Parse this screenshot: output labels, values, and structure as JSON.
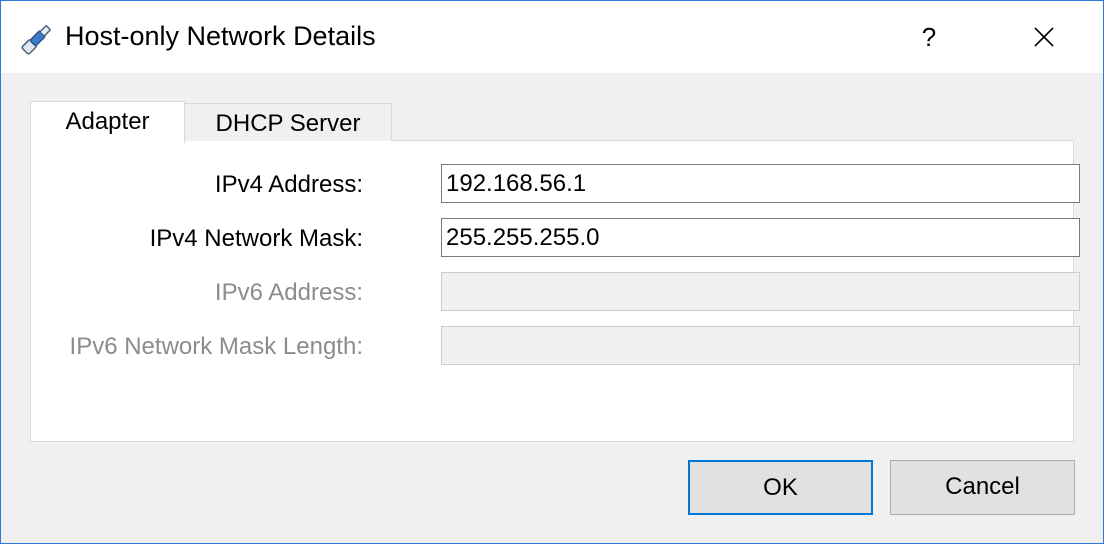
{
  "window": {
    "title": "Host-only Network Details",
    "icon": "network-adapter-icon",
    "help_label": "?",
    "close_icon": "close-icon",
    "accent_color": "#2b79d8"
  },
  "tabs": [
    {
      "label": "Adapter",
      "selected": true
    },
    {
      "label": "DHCP Server",
      "selected": false
    }
  ],
  "fields": {
    "ipv4_address": {
      "label": "IPv4 Address:",
      "value": "192.168.56.1",
      "enabled": true
    },
    "ipv4_mask": {
      "label": "IPv4 Network Mask:",
      "value": "255.255.255.0",
      "enabled": true
    },
    "ipv6_address": {
      "label": "IPv6 Address:",
      "value": "",
      "enabled": false
    },
    "ipv6_mask_length": {
      "label": "IPv6 Network Mask Length:",
      "value": "",
      "enabled": false
    }
  },
  "buttons": {
    "ok": "OK",
    "cancel": "Cancel"
  }
}
